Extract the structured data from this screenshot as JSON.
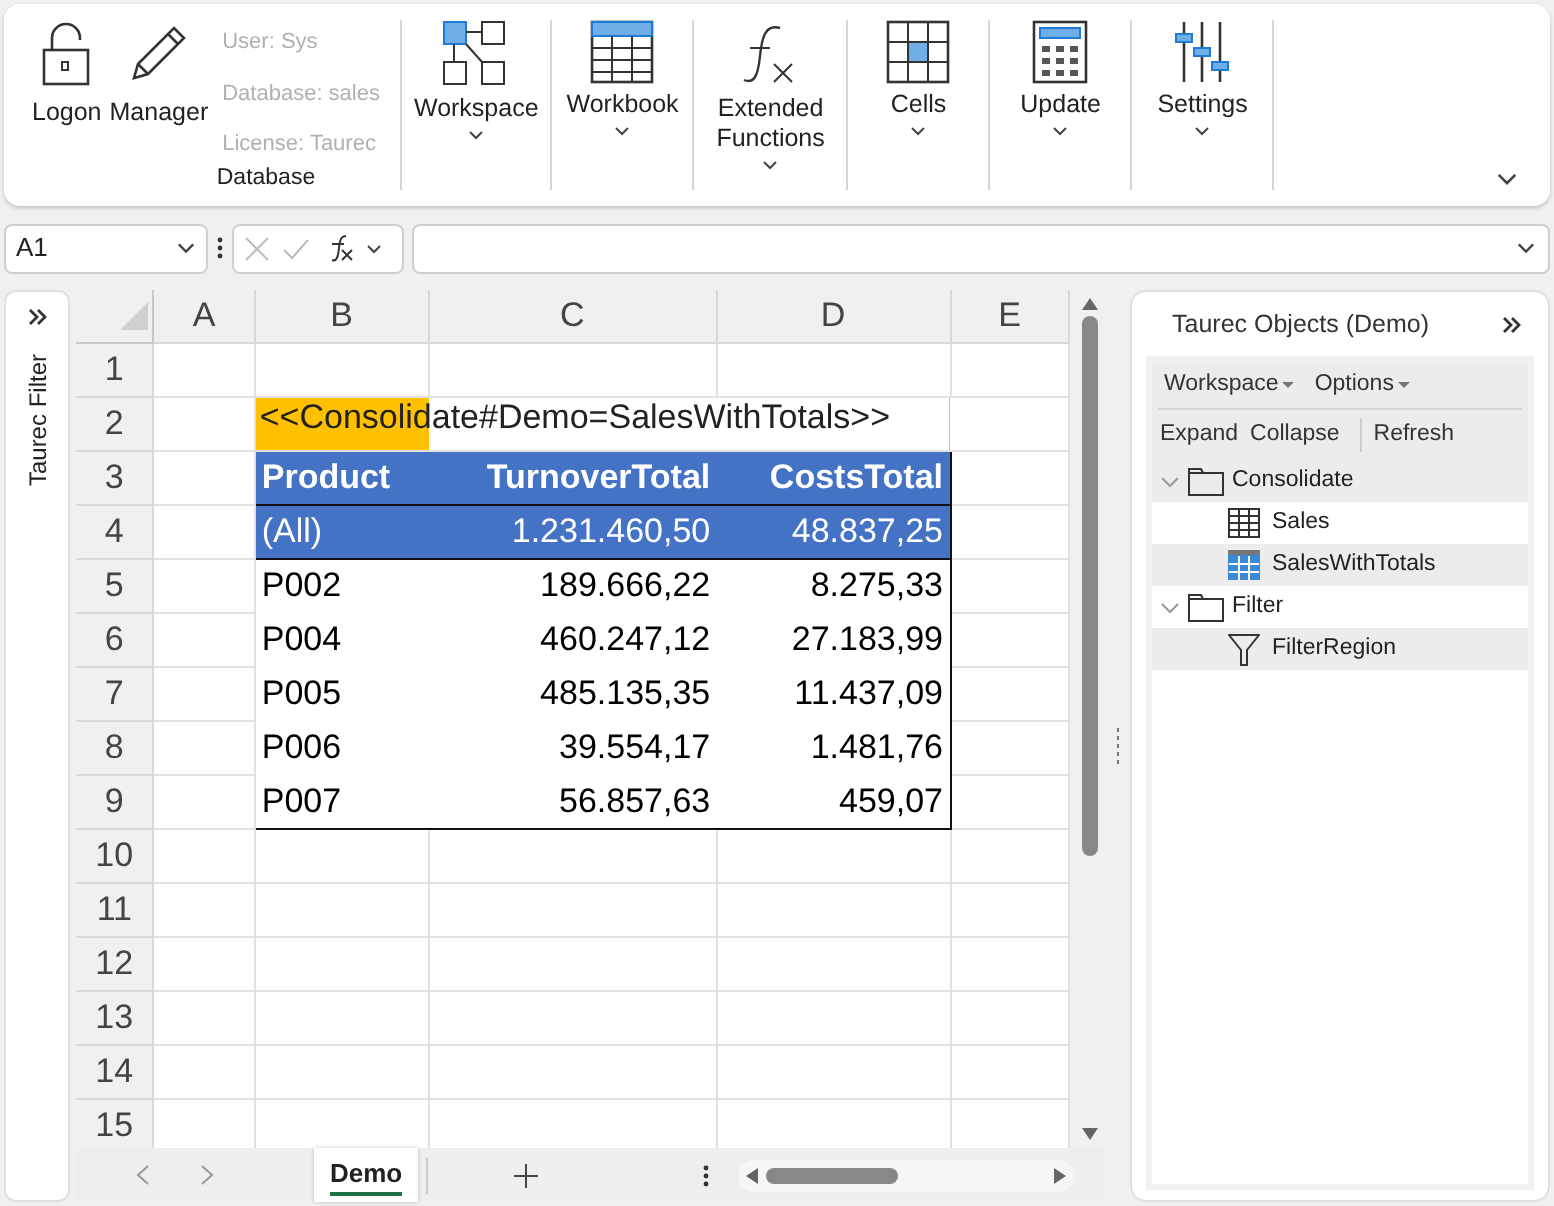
{
  "ribbon": {
    "database_group": {
      "buttons": [
        {
          "kind": "lock",
          "label": "Logon"
        },
        {
          "kind": "pencil",
          "label": "Manager"
        }
      ],
      "info": [
        "User: Sys",
        "Database: sales",
        "License: Taurec"
      ],
      "label": "Database"
    },
    "buttons": [
      {
        "kind": "workspace",
        "label": "Workspace"
      },
      {
        "kind": "workbook",
        "label": "Workbook"
      },
      {
        "kind": "function",
        "label": "Extended Functions"
      },
      {
        "kind": "cells",
        "label": "Cells"
      },
      {
        "kind": "update",
        "label": "Update"
      },
      {
        "kind": "settings",
        "label": "Settings"
      }
    ]
  },
  "formula_bar": {
    "name_box": "A1"
  },
  "left_pane": {
    "title": "Taurec Filter"
  },
  "sheet": {
    "columns": [
      {
        "letter": "A"
      },
      {
        "letter": "B",
        "header": "Product"
      },
      {
        "letter": "C",
        "header": "TurnoverTotal"
      },
      {
        "letter": "D",
        "header": "CostsTotal"
      },
      {
        "letter": "E"
      }
    ],
    "row_numbers": [
      "1",
      "2",
      "3",
      "4",
      "5",
      "6",
      "7",
      "8",
      "9",
      "10",
      "11",
      "12",
      "13",
      "14",
      "15"
    ],
    "template_cell": "<<Consolidate#Demo=SalesWithTotals>>",
    "rows": [
      {
        "kind": "total",
        "cells": [
          null,
          "(All)",
          "1.231.460,50",
          "48.837,25"
        ]
      },
      {
        "kind": "data",
        "cells": [
          null,
          "P002",
          "189.666,22",
          "8.275,33"
        ]
      },
      {
        "kind": "data",
        "cells": [
          null,
          "P004",
          "460.247,12",
          "27.183,99"
        ]
      },
      {
        "kind": "data",
        "cells": [
          null,
          "P005",
          "485.135,35",
          "11.437,09"
        ]
      },
      {
        "kind": "data",
        "cells": [
          null,
          "P006",
          "39.554,17",
          "1.481,76"
        ]
      },
      {
        "kind": "data",
        "cells": [
          null,
          "P007",
          "56.857,63",
          "459,07"
        ]
      }
    ]
  },
  "sheet_tabs": [
    {
      "label": "Demo",
      "selected": true
    }
  ],
  "right_pane": {
    "title": "Taurec Objects (Demo)",
    "menus": [
      "Workspace",
      "Options"
    ],
    "actions": [
      "Expand",
      "Collapse",
      "Refresh"
    ],
    "tree": [
      {
        "kind": "folder",
        "label": "Consolidate",
        "expanded": true,
        "children": [
          {
            "kind": "table",
            "label": "Sales"
          },
          {
            "kind": "table_totals",
            "label": "SalesWithTotals"
          }
        ]
      },
      {
        "kind": "folder",
        "label": "Filter",
        "expanded": true,
        "children": [
          {
            "kind": "filter",
            "label": "FilterRegion"
          }
        ]
      }
    ]
  }
}
